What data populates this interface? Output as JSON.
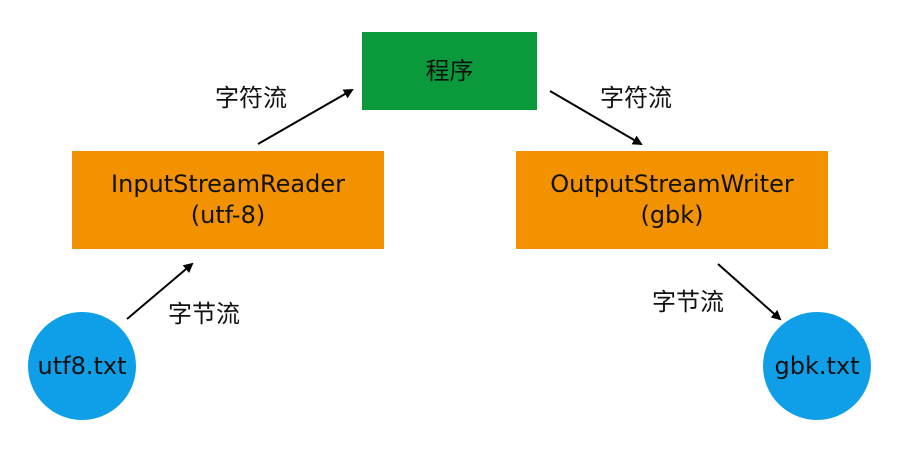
{
  "colors": {
    "program_box": "#0a9a3c",
    "stream_box": "#f39200",
    "file_circle": "#0f9fe8",
    "arrow": "#000000"
  },
  "nodes": {
    "program": {
      "label": "程序"
    },
    "reader": {
      "line1": "InputStreamReader",
      "line2": "(utf-8)"
    },
    "writer": {
      "line1": "OutputStreamWriter",
      "line2": "(gbk)"
    },
    "source_file": {
      "label": "utf8.txt"
    },
    "target_file": {
      "label": "gbk.txt"
    }
  },
  "edges": {
    "source_to_reader": {
      "label": "字节流"
    },
    "reader_to_program": {
      "label": "字符流"
    },
    "program_to_writer": {
      "label": "字符流"
    },
    "writer_to_target": {
      "label": "字节流"
    }
  }
}
